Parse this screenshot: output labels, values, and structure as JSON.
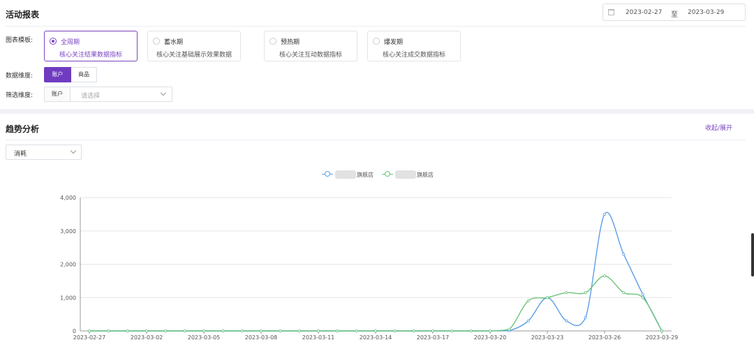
{
  "header": {
    "title": "活动报表"
  },
  "date_range": {
    "start": "2023-02-27",
    "separator": "至",
    "end": "2023-03-29"
  },
  "filters": {
    "template_label": "图表模板:",
    "templates": [
      {
        "name": "全周期",
        "desc": "核心关注结果数据指标",
        "selected": true
      },
      {
        "name": "蓄水期",
        "desc": "核心关注基础展示效果数据",
        "selected": false
      },
      {
        "name": "预热期",
        "desc": "核心关注互动数据指标",
        "selected": false
      },
      {
        "name": "爆发期",
        "desc": "核心关注成交数据指标",
        "selected": false
      }
    ],
    "dimension_label": "数据维度:",
    "dimension_options": [
      "账户",
      "商品"
    ],
    "dimension_selected": "账户",
    "filter_label": "筛选维度:",
    "filter_prefix": "账户",
    "filter_placeholder": "请选择"
  },
  "trend": {
    "title": "趋势分析",
    "collapse_label": "收起/展开",
    "metric_selected": "消耗"
  },
  "legend": [
    {
      "name": "旗舰店",
      "color": "#5b9ee6"
    },
    {
      "name": "旗舰店",
      "color": "#6cc47b"
    }
  ],
  "chart_data": {
    "type": "line",
    "x": [
      "2023-02-27",
      "2023-02-28",
      "2023-03-01",
      "2023-03-02",
      "2023-03-03",
      "2023-03-04",
      "2023-03-05",
      "2023-03-06",
      "2023-03-07",
      "2023-03-08",
      "2023-03-09",
      "2023-03-10",
      "2023-03-11",
      "2023-03-12",
      "2023-03-13",
      "2023-03-14",
      "2023-03-15",
      "2023-03-16",
      "2023-03-17",
      "2023-03-18",
      "2023-03-19",
      "2023-03-20",
      "2023-03-21",
      "2023-03-22",
      "2023-03-23",
      "2023-03-24",
      "2023-03-25",
      "2023-03-26",
      "2023-03-27",
      "2023-03-28",
      "2023-03-29"
    ],
    "x_tick_labels": [
      "2023-02-27",
      "2023-03-02",
      "2023-03-05",
      "2023-03-08",
      "2023-03-11",
      "2023-03-14",
      "2023-03-17",
      "2023-03-20",
      "2023-03-23",
      "2023-03-26",
      "2023-03-29"
    ],
    "series": [
      {
        "name": "旗舰店",
        "color": "#5b9ee6",
        "values": [
          0,
          0,
          0,
          0,
          0,
          0,
          0,
          0,
          0,
          0,
          0,
          0,
          0,
          0,
          0,
          0,
          0,
          0,
          0,
          0,
          0,
          0,
          10,
          300,
          1000,
          300,
          400,
          3500,
          2300,
          1100,
          0
        ]
      },
      {
        "name": "旗舰店",
        "color": "#6cc47b",
        "values": [
          0,
          0,
          0,
          0,
          0,
          0,
          0,
          0,
          0,
          0,
          0,
          0,
          0,
          0,
          0,
          0,
          0,
          0,
          0,
          0,
          0,
          0,
          50,
          900,
          1000,
          1150,
          1150,
          1650,
          1150,
          1000,
          0
        ]
      }
    ],
    "ylim": [
      0,
      4000
    ],
    "y_ticks": [
      0,
      1000,
      2000,
      3000,
      4000
    ],
    "y_tick_labels": [
      "0",
      "1,000",
      "2,000",
      "3,000",
      "4,000"
    ],
    "grid": true,
    "legend_position": "top-center"
  }
}
